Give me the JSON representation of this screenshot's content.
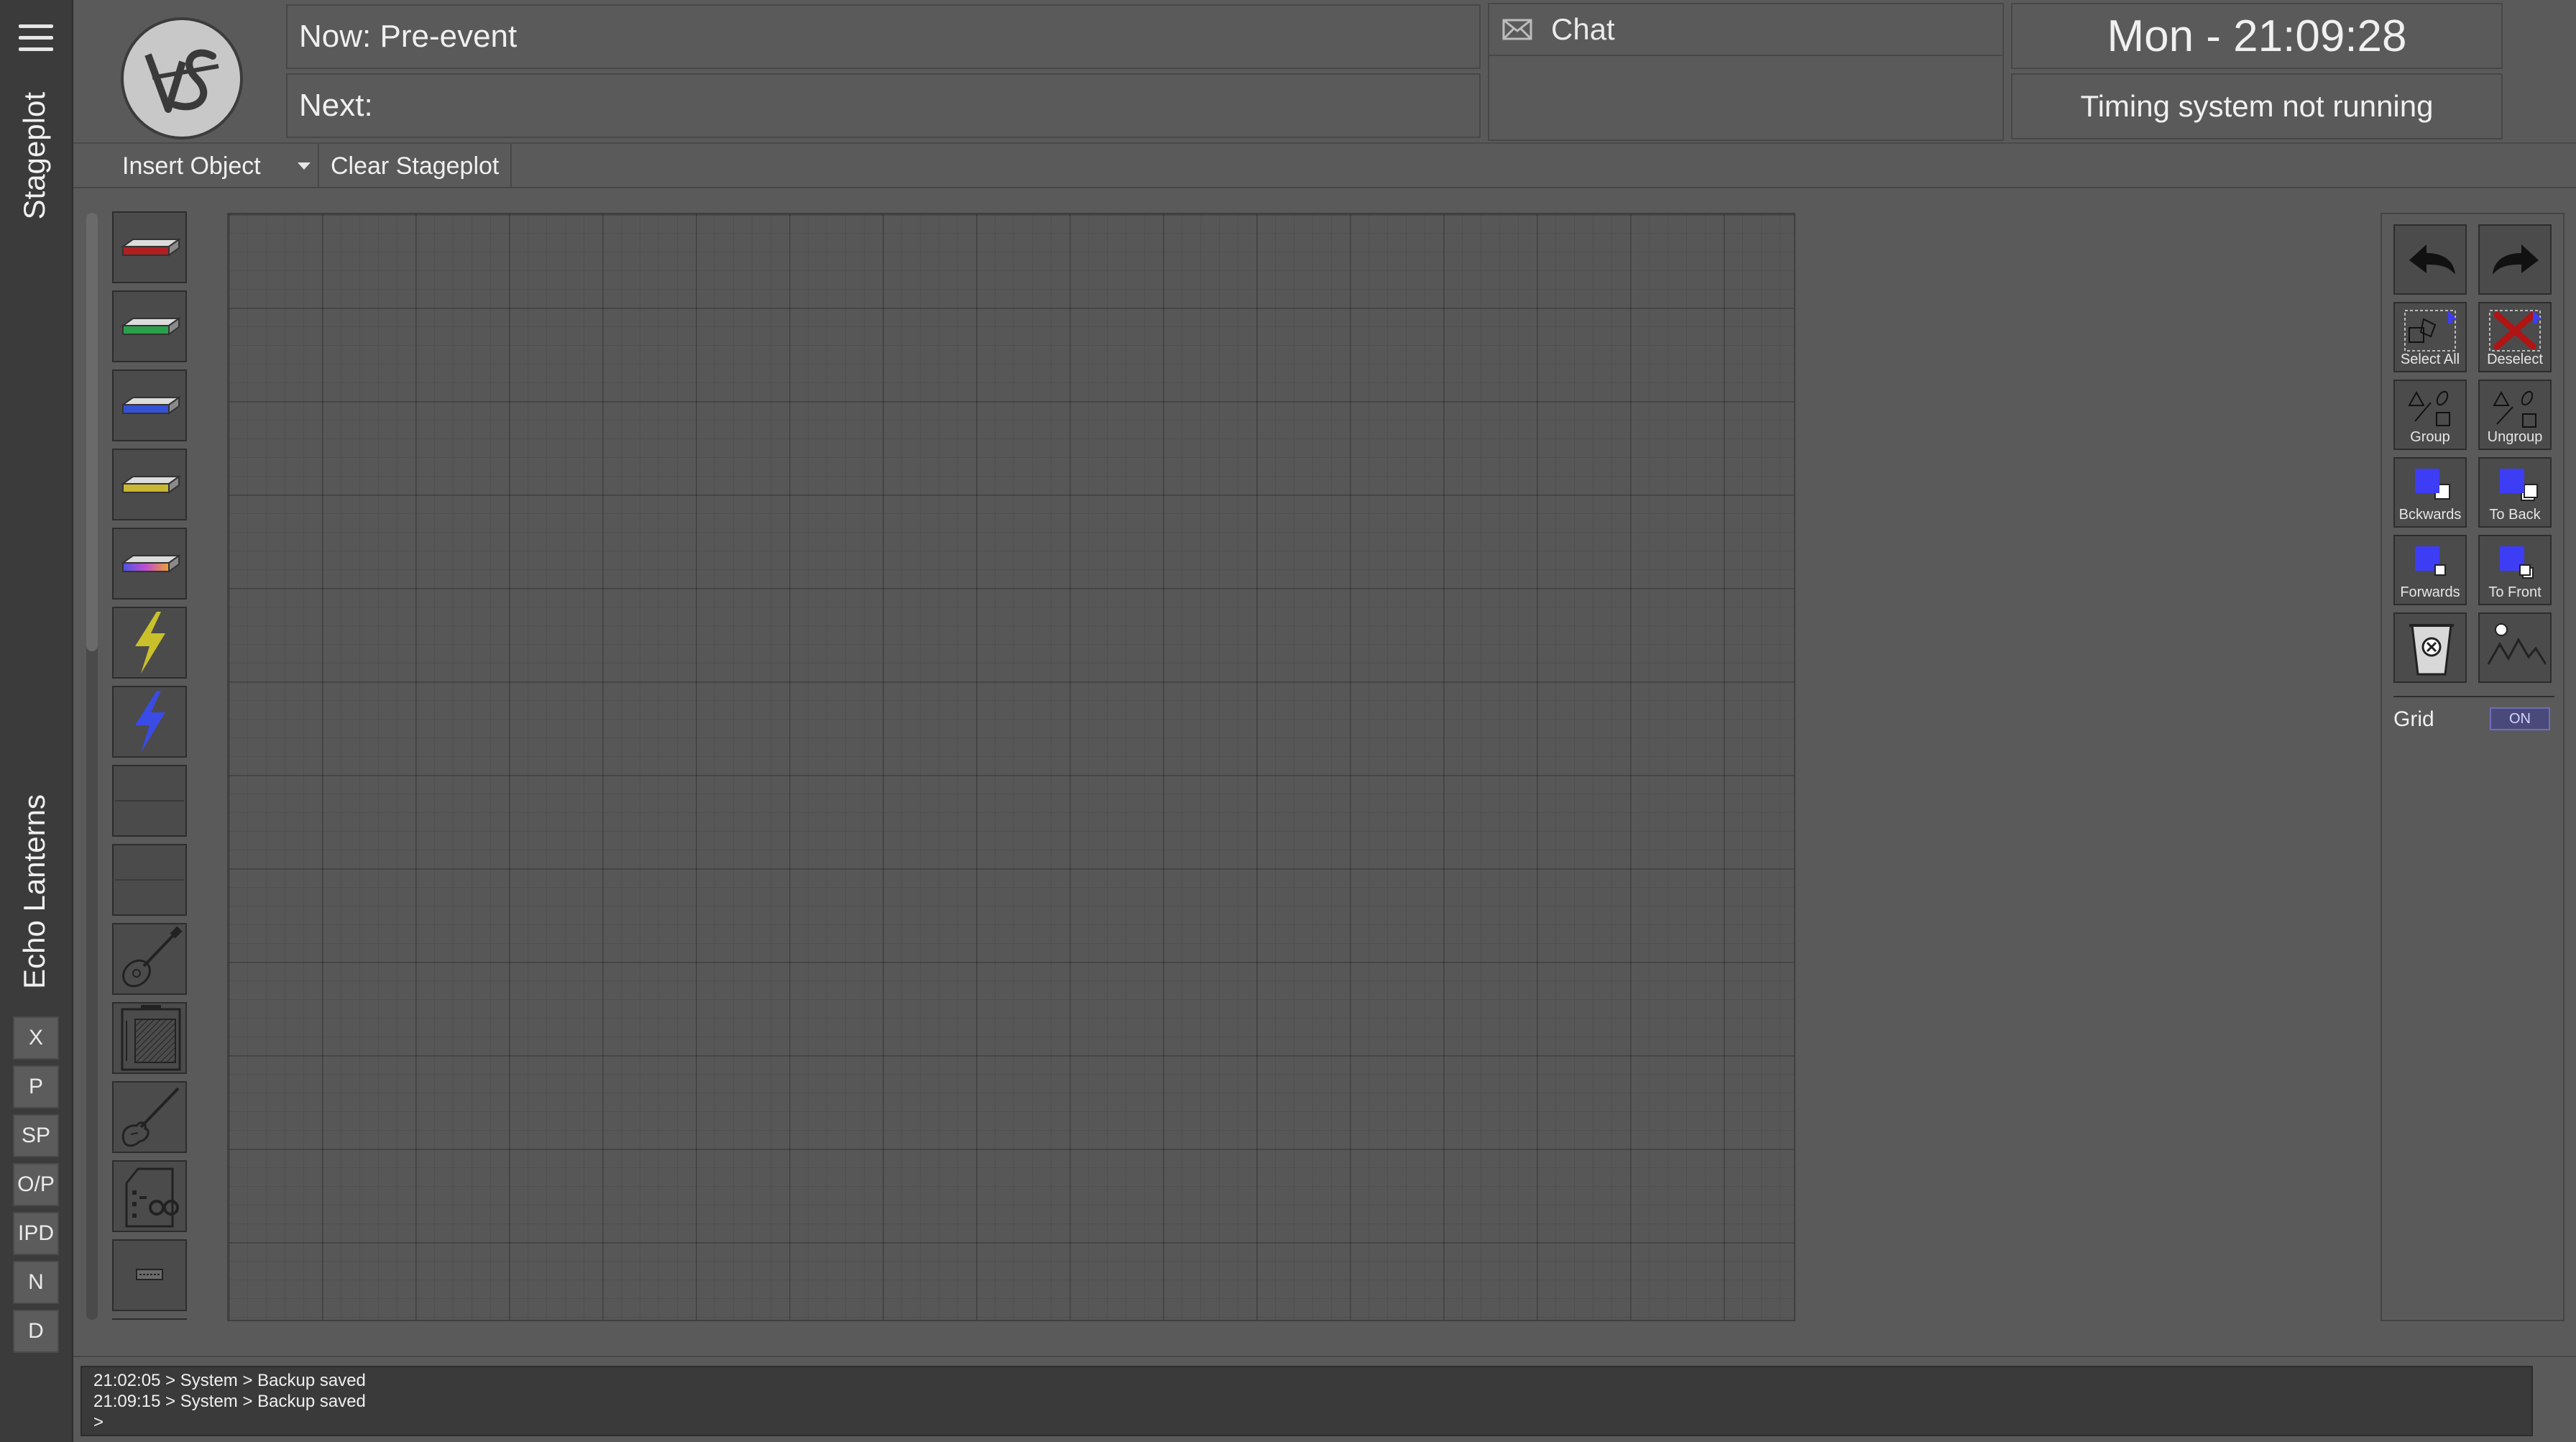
{
  "rail": {
    "stageplot_label": "Stageplot",
    "venue_label": "Echo Lanterns",
    "buttons": [
      "X",
      "P",
      "SP",
      "O/P",
      "IPD",
      "N",
      "D"
    ]
  },
  "header": {
    "logo_text": "VS",
    "now": "Now: Pre-event",
    "next": "Next:",
    "chat_title": "Chat",
    "clock": "Mon - 21:09:28",
    "timing_status": "Timing system not running"
  },
  "toolbar": {
    "insert_object": "Insert Object",
    "clear_stageplot": "Clear Stageplot"
  },
  "palette": {
    "items": [
      {
        "name": "riser-red",
        "color": "#b02020"
      },
      {
        "name": "riser-green",
        "color": "#2aa04a"
      },
      {
        "name": "riser-blue",
        "color": "#3452d6"
      },
      {
        "name": "riser-yellow",
        "color": "#c9b632"
      },
      {
        "name": "riser-rainbow",
        "color": "#9b59d0"
      },
      {
        "name": "power-yellow",
        "color": "#c9c02c"
      },
      {
        "name": "power-blue",
        "color": "#3a4be6"
      },
      {
        "name": "blank-1",
        "color": ""
      },
      {
        "name": "blank-2",
        "color": ""
      },
      {
        "name": "acoustic-guitar",
        "color": ""
      },
      {
        "name": "guitar-amp",
        "color": ""
      },
      {
        "name": "electric-guitar",
        "color": ""
      },
      {
        "name": "bass-cabinet",
        "color": ""
      },
      {
        "name": "keyboard",
        "color": ""
      },
      {
        "name": "partial",
        "color": ""
      }
    ]
  },
  "tools": {
    "undo": "undo-icon",
    "redo": "redo-icon",
    "select_all": "Select All",
    "deselect": "Deselect",
    "group": "Group",
    "ungroup": "Ungroup",
    "backwards": "Bckwards",
    "to_back": "To Back",
    "forwards": "Forwards",
    "to_front": "To Front",
    "grid_label": "Grid",
    "grid_state": "ON",
    "accent_color": "#3d3df5"
  },
  "console": {
    "lines": [
      "21:02:05 > System > Backup saved",
      "21:09:15 > System > Backup saved",
      ">"
    ]
  }
}
